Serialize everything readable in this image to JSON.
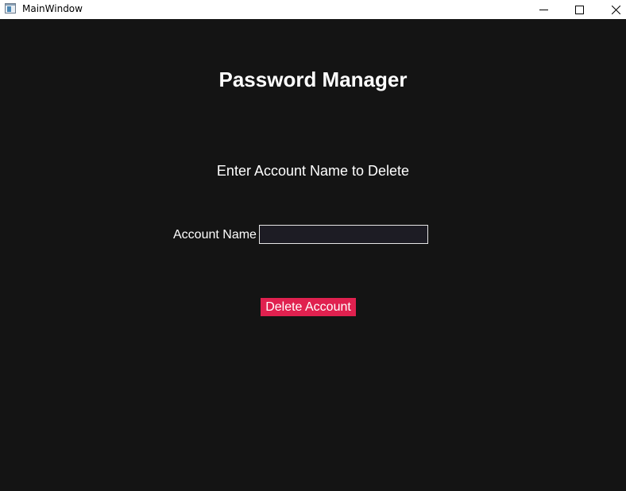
{
  "window": {
    "title": "MainWindow",
    "controls": {
      "minimize": "minimize-icon",
      "maximize": "maximize-icon",
      "close": "close-icon"
    }
  },
  "app": {
    "title": "Password Manager",
    "instruction": "Enter Account Name to Delete"
  },
  "form": {
    "account_name_label": "Account Name",
    "account_name_value": ""
  },
  "actions": {
    "delete_label": "Delete Account"
  },
  "colors": {
    "background": "#141414",
    "accent": "#e0214f",
    "input_background": "#1d1c24",
    "text": "#ffffff"
  }
}
